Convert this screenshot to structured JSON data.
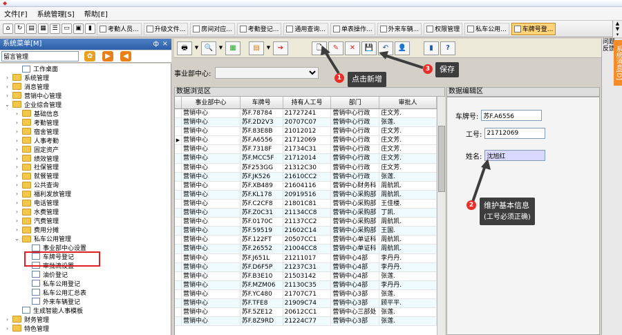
{
  "menubar": {
    "items": [
      "文件[F]",
      "系统管理[S]",
      "帮助[E]"
    ]
  },
  "tabs": [
    {
      "label": "考勤人员..."
    },
    {
      "label": "升级文件..."
    },
    {
      "label": "房间对应..."
    },
    {
      "label": "考勤登记..."
    },
    {
      "label": "通用查询..."
    },
    {
      "label": "单表操作..."
    },
    {
      "label": "外来车辆..."
    },
    {
      "label": "权限管理"
    },
    {
      "label": "私车公用..."
    },
    {
      "label": "车牌号登..."
    }
  ],
  "left_panel": {
    "title": "系统菜单[M]",
    "pin": "ф",
    "close": "×",
    "search_value": "留言管理"
  },
  "tree": [
    {
      "label": "工作桌面",
      "level": 1,
      "icon": "doc",
      "exp": ""
    },
    {
      "label": "系统管理",
      "level": 0,
      "icon": "folder",
      "exp": "›"
    },
    {
      "label": "消息管理",
      "level": 0,
      "icon": "folder",
      "exp": "›"
    },
    {
      "label": "营销中心管理",
      "level": 0,
      "icon": "folder",
      "exp": "›"
    },
    {
      "label": "企业综合管理",
      "level": 0,
      "icon": "folder",
      "exp": "⌄"
    },
    {
      "label": "基础信息",
      "level": 1,
      "icon": "folder",
      "exp": "›"
    },
    {
      "label": "考勤管理",
      "level": 1,
      "icon": "folder",
      "exp": "›"
    },
    {
      "label": "宿舍管理",
      "level": 1,
      "icon": "folder",
      "exp": "›"
    },
    {
      "label": "人事考勤",
      "level": 1,
      "icon": "folder",
      "exp": "›"
    },
    {
      "label": "固定资产",
      "level": 1,
      "icon": "folder",
      "exp": "›"
    },
    {
      "label": "绩效管理",
      "level": 1,
      "icon": "folder",
      "exp": "›"
    },
    {
      "label": "社保管理",
      "level": 1,
      "icon": "folder",
      "exp": "›"
    },
    {
      "label": "就餐管理",
      "level": 1,
      "icon": "folder",
      "exp": "›"
    },
    {
      "label": "公共查询",
      "level": 1,
      "icon": "folder",
      "exp": "›"
    },
    {
      "label": "福利发放管理",
      "level": 1,
      "icon": "folder",
      "exp": "›"
    },
    {
      "label": "电话管理",
      "level": 1,
      "icon": "folder",
      "exp": "›"
    },
    {
      "label": "水费管理",
      "level": 1,
      "icon": "folder",
      "exp": "›"
    },
    {
      "label": "汽费管理",
      "level": 1,
      "icon": "folder",
      "exp": "›"
    },
    {
      "label": "费用分摊",
      "level": 1,
      "icon": "folder",
      "exp": "›"
    },
    {
      "label": "私车公用管理",
      "level": 1,
      "icon": "folder",
      "exp": "⌄"
    },
    {
      "label": "事业部中心设置",
      "level": 2,
      "icon": "doc",
      "exp": ""
    },
    {
      "label": "车牌号登记",
      "level": 2,
      "icon": "doc",
      "exp": ""
    },
    {
      "label": "审批流设置",
      "level": 2,
      "icon": "doc",
      "exp": ""
    },
    {
      "label": "油价登记",
      "level": 2,
      "icon": "doc",
      "exp": ""
    },
    {
      "label": "私车公用登记",
      "level": 2,
      "icon": "doc",
      "exp": ""
    },
    {
      "label": "私车公用汇总表",
      "level": 2,
      "icon": "doc",
      "exp": ""
    },
    {
      "label": "外来车辆登记",
      "level": 2,
      "icon": "doc",
      "exp": ""
    },
    {
      "label": "生成智能人事模板",
      "level": 1,
      "icon": "doc",
      "exp": ""
    },
    {
      "label": "财务管理",
      "level": 0,
      "icon": "folder",
      "exp": "›"
    },
    {
      "label": "特色管理",
      "level": 0,
      "icon": "folder",
      "exp": "›"
    }
  ],
  "toolbar_icons": {
    "print": "🖶",
    "preview": "🔍",
    "chart": "▦",
    "export": "▤",
    "exit": "➔",
    "new": "🗋",
    "edit": "✎",
    "delete": "✕",
    "save": "💾",
    "undo": "↶",
    "user": "👤",
    "book": "▮",
    "help": "?"
  },
  "filter": {
    "label": "事业部中心:",
    "value": ""
  },
  "grid": {
    "title": "数据浏览区",
    "columns": [
      "事业部中心",
      "车牌号",
      "持有人工号",
      "部门",
      "审批人"
    ],
    "rows": [
      [
        "营销中心",
        "苏F.78784",
        "21727241",
        "营销中心行政",
        "庄文芳."
      ],
      [
        "营销中心",
        "苏F.2D2V3",
        "20707C07",
        "营销中心行政",
        "张莲."
      ],
      [
        "营销中心",
        "苏F.83E8B",
        "21012012",
        "营销中心行政",
        "庄文芳."
      ],
      [
        "营销中心",
        "苏F.A6556",
        "21712069",
        "营销中心行政",
        "庄文芳."
      ],
      [
        "营销中心",
        "苏F.7318F",
        "21734C31",
        "营销中心行政",
        "庄文芳."
      ],
      [
        "营销中心",
        "苏F.MCC5F",
        "21712014",
        "营销中心行政",
        "庄文芳."
      ],
      [
        "营销中心",
        "苏F253GG",
        "21312C30",
        "营销中心行政",
        "庄文芳."
      ],
      [
        "营销中心",
        "苏F.JK526",
        "21610CC2",
        "营销中心行政",
        "张莲."
      ],
      [
        "营销中心",
        "苏F.XB489",
        "21604116",
        "营销中心财务科",
        "周航凯."
      ],
      [
        "营销中心",
        "苏F.KL178",
        "20919516",
        "营销中心采购部",
        "周航凯."
      ],
      [
        "营销中心",
        "苏F.C2CF8",
        "21801C81",
        "营销中心采购部",
        "王佳楼."
      ],
      [
        "营销中心",
        "苏F.Z0C31",
        "21134CC8",
        "营销中心采购部",
        "丁凯."
      ],
      [
        "营销中心",
        "苏F.0170C",
        "21137CC2",
        "营销中心采购部",
        "周航凯."
      ],
      [
        "营销中心",
        "苏F.59519",
        "21602C14",
        "营销中心采购部",
        "王国."
      ],
      [
        "营销中心",
        "苏F.122FT",
        "20507CC1",
        "营销中心单证科",
        "周航凯."
      ],
      [
        "营销中心",
        "苏F.26552",
        "21004CC8",
        "营销中心单证科",
        "周航凯."
      ],
      [
        "营销中心",
        "苏F.J651L",
        "21211017",
        "营销中心4部",
        "李丹丹."
      ],
      [
        "营销中心",
        "苏F.D6F5P",
        "21237C31",
        "营销中心4部",
        "李丹丹."
      ],
      [
        "营销中心",
        "苏F.B3E10",
        "21503142",
        "营销中心4部",
        "张莲."
      ],
      [
        "营销中心",
        "苏F.MZM06",
        "21130C35",
        "营销中心4部",
        "李丹丹."
      ],
      [
        "营销中心",
        "苏F.YC480",
        "21707C71",
        "营销中心3部",
        "张莲."
      ],
      [
        "营销中心",
        "苏F.TFE8",
        "21909C74",
        "营销中心3部",
        "顾平平."
      ],
      [
        "营销中心",
        "苏F.5ZE12",
        "20612CC1",
        "营销中心三部处",
        "张莲."
      ],
      [
        "营销中心",
        "苏F.8Z9RD",
        "21224C77",
        "营销中心3部",
        "张莲."
      ]
    ]
  },
  "detail": {
    "title": "数据编辑区",
    "plate_label": "车牌号:",
    "plate_value": "苏F.A6556",
    "id_label": "工号:",
    "id_value": "21712069",
    "name_label": "姓名:",
    "name_value": "沈旭红"
  },
  "right_dock": {
    "help": "问题反馈",
    "tab": "系统消息[D]"
  },
  "annotations": {
    "badge1": "1",
    "callout1": "点击新增",
    "badge2": "2",
    "callout2_line1": "维护基本信息",
    "callout2_line2": "(工号必须正确)",
    "badge3": "3",
    "callout3": "保存"
  },
  "colors": {
    "accent": "#2a5ea8",
    "active_tab": "#ffd37a",
    "callout_bg": "#3d3d3d",
    "badge": "#e8302a",
    "highlight_box": "#e02020",
    "dock_tab": "#f48c2a"
  }
}
